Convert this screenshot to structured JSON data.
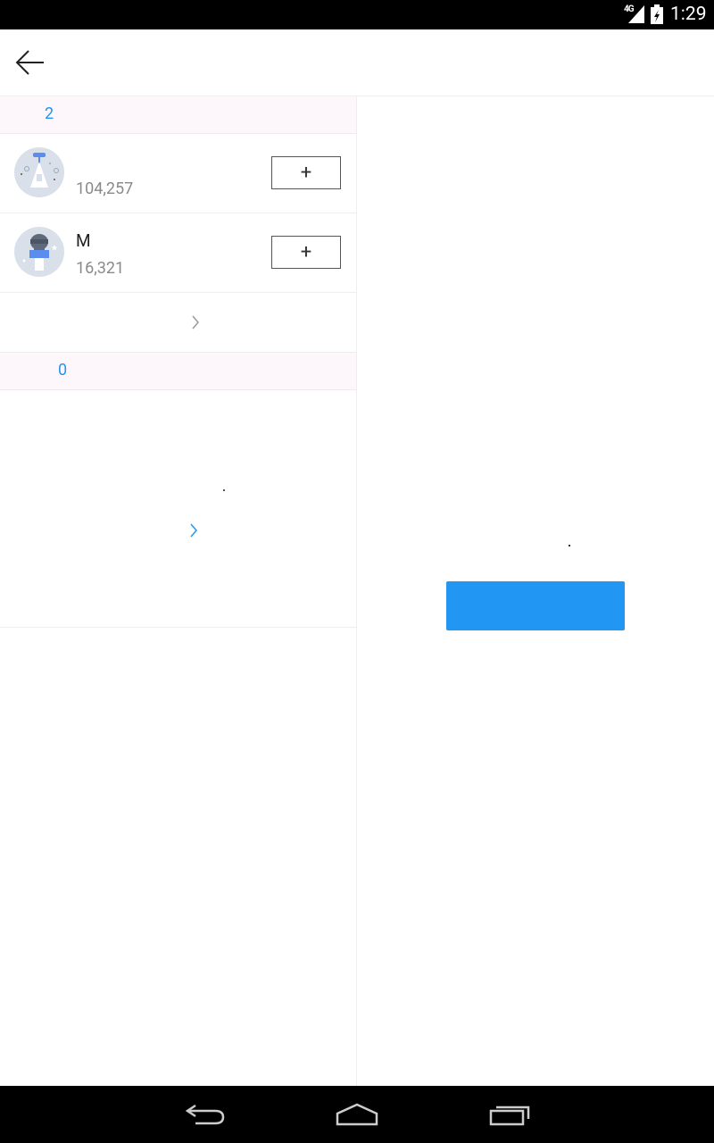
{
  "status_bar": {
    "network": "4G",
    "time": "1:29"
  },
  "app_bar": {
    "back_icon": "arrow-left-icon"
  },
  "section_1": {
    "count": "2",
    "items": [
      {
        "name": "",
        "count": "104,257",
        "avatar_icon": "lamp-astronaut-avatar-icon",
        "follow_label": "+"
      },
      {
        "name": "M",
        "count": "16,321",
        "avatar_icon": "helmet-person-avatar-icon",
        "follow_label": "+"
      }
    ],
    "more_icon": "chevron-right-icon"
  },
  "section_2": {
    "count": "0",
    "link_icon": "chevron-right-icon"
  },
  "right_pane": {
    "primary_button_label": ""
  },
  "nav_bar": {
    "back_icon": "back-icon",
    "home_icon": "home-icon",
    "recents_icon": "recents-icon"
  },
  "colors": {
    "accent": "#2196f3",
    "section_header_bg": "#fdf7fb"
  }
}
